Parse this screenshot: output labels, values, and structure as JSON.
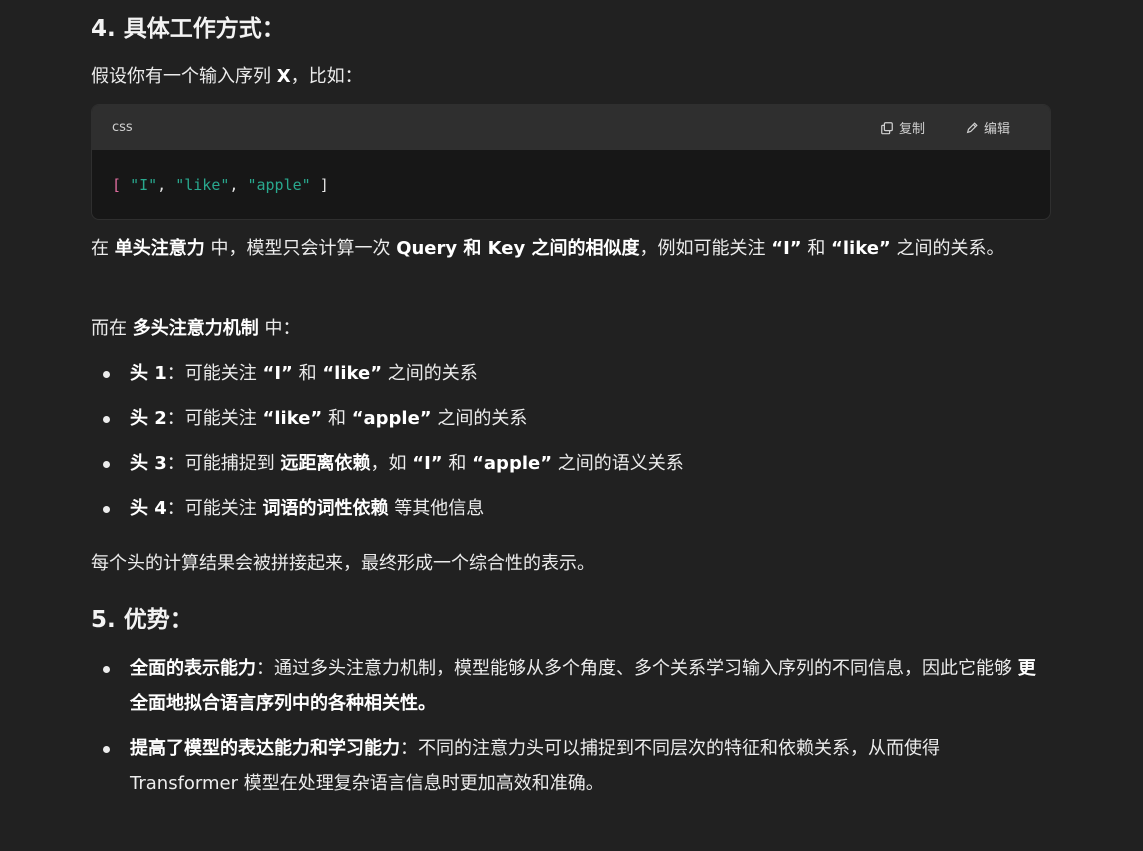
{
  "section4": {
    "title": "4. 具体工作方式：",
    "intro": {
      "t1": "假设你有一个输入序列 ",
      "b1": "X",
      "t2": "，比如："
    }
  },
  "code": {
    "lang": "css",
    "copy_label": "复制",
    "edit_label": "编辑",
    "open": "[",
    "s1": "\"I\"",
    "s2": "\"like\"",
    "s3": "\"apple\"",
    "comma": ",",
    "close": "]"
  },
  "para1": {
    "t1": "在 ",
    "b1": "单头注意力",
    "t2": " 中，模型只会计算一次 ",
    "b2": "Query 和 Key 之间的相似度",
    "t3": "，例如可能关注 ",
    "b3": "“I”",
    "t4": " 和 ",
    "b4": "“like”",
    "t5": " 之间的关系。"
  },
  "para2": {
    "t1": "而在 ",
    "b1": "多头注意力机制",
    "t2": " 中："
  },
  "heads": [
    {
      "b1": "头 1",
      "t1": "：可能关注 ",
      "b2": "“I”",
      "t2": " 和 ",
      "b3": "“like”",
      "t3": " 之间的关系"
    },
    {
      "b1": "头 2",
      "t1": "：可能关注 ",
      "b2": "“like”",
      "t2": " 和 ",
      "b3": "“apple”",
      "t3": " 之间的关系"
    },
    {
      "b1": "头 3",
      "t1": "：可能捕捉到 ",
      "b2": "远距离依赖",
      "t2": "，如 ",
      "b3": "“I”",
      "t3": " 和 ",
      "b4": "“apple”",
      "t4": " 之间的语义关系"
    },
    {
      "b1": "头 4",
      "t1": "：可能关注 ",
      "b2": "词语的词性依赖",
      "t2": " 等其他信息"
    }
  ],
  "para3": "每个头的计算结果会被拼接起来，最终形成一个综合性的表示。",
  "section5": {
    "title": "5. 优势："
  },
  "advantages": [
    {
      "b1": "全面的表示能力",
      "t1": "：通过多头注意力机制，模型能够从多个角度、多个关系学习输入序列的不同信息，因此它能够 ",
      "b2": "更全面地拟合语言序列中的各种相关性。"
    },
    {
      "b1": "提高了模型的表达能力和学习能力",
      "t1": "：不同的注意力头可以捕捉到不同层次的特征和依赖关系，从而使得 Transformer 模型在处理复杂语言信息时更加高效和准确。"
    }
  ]
}
